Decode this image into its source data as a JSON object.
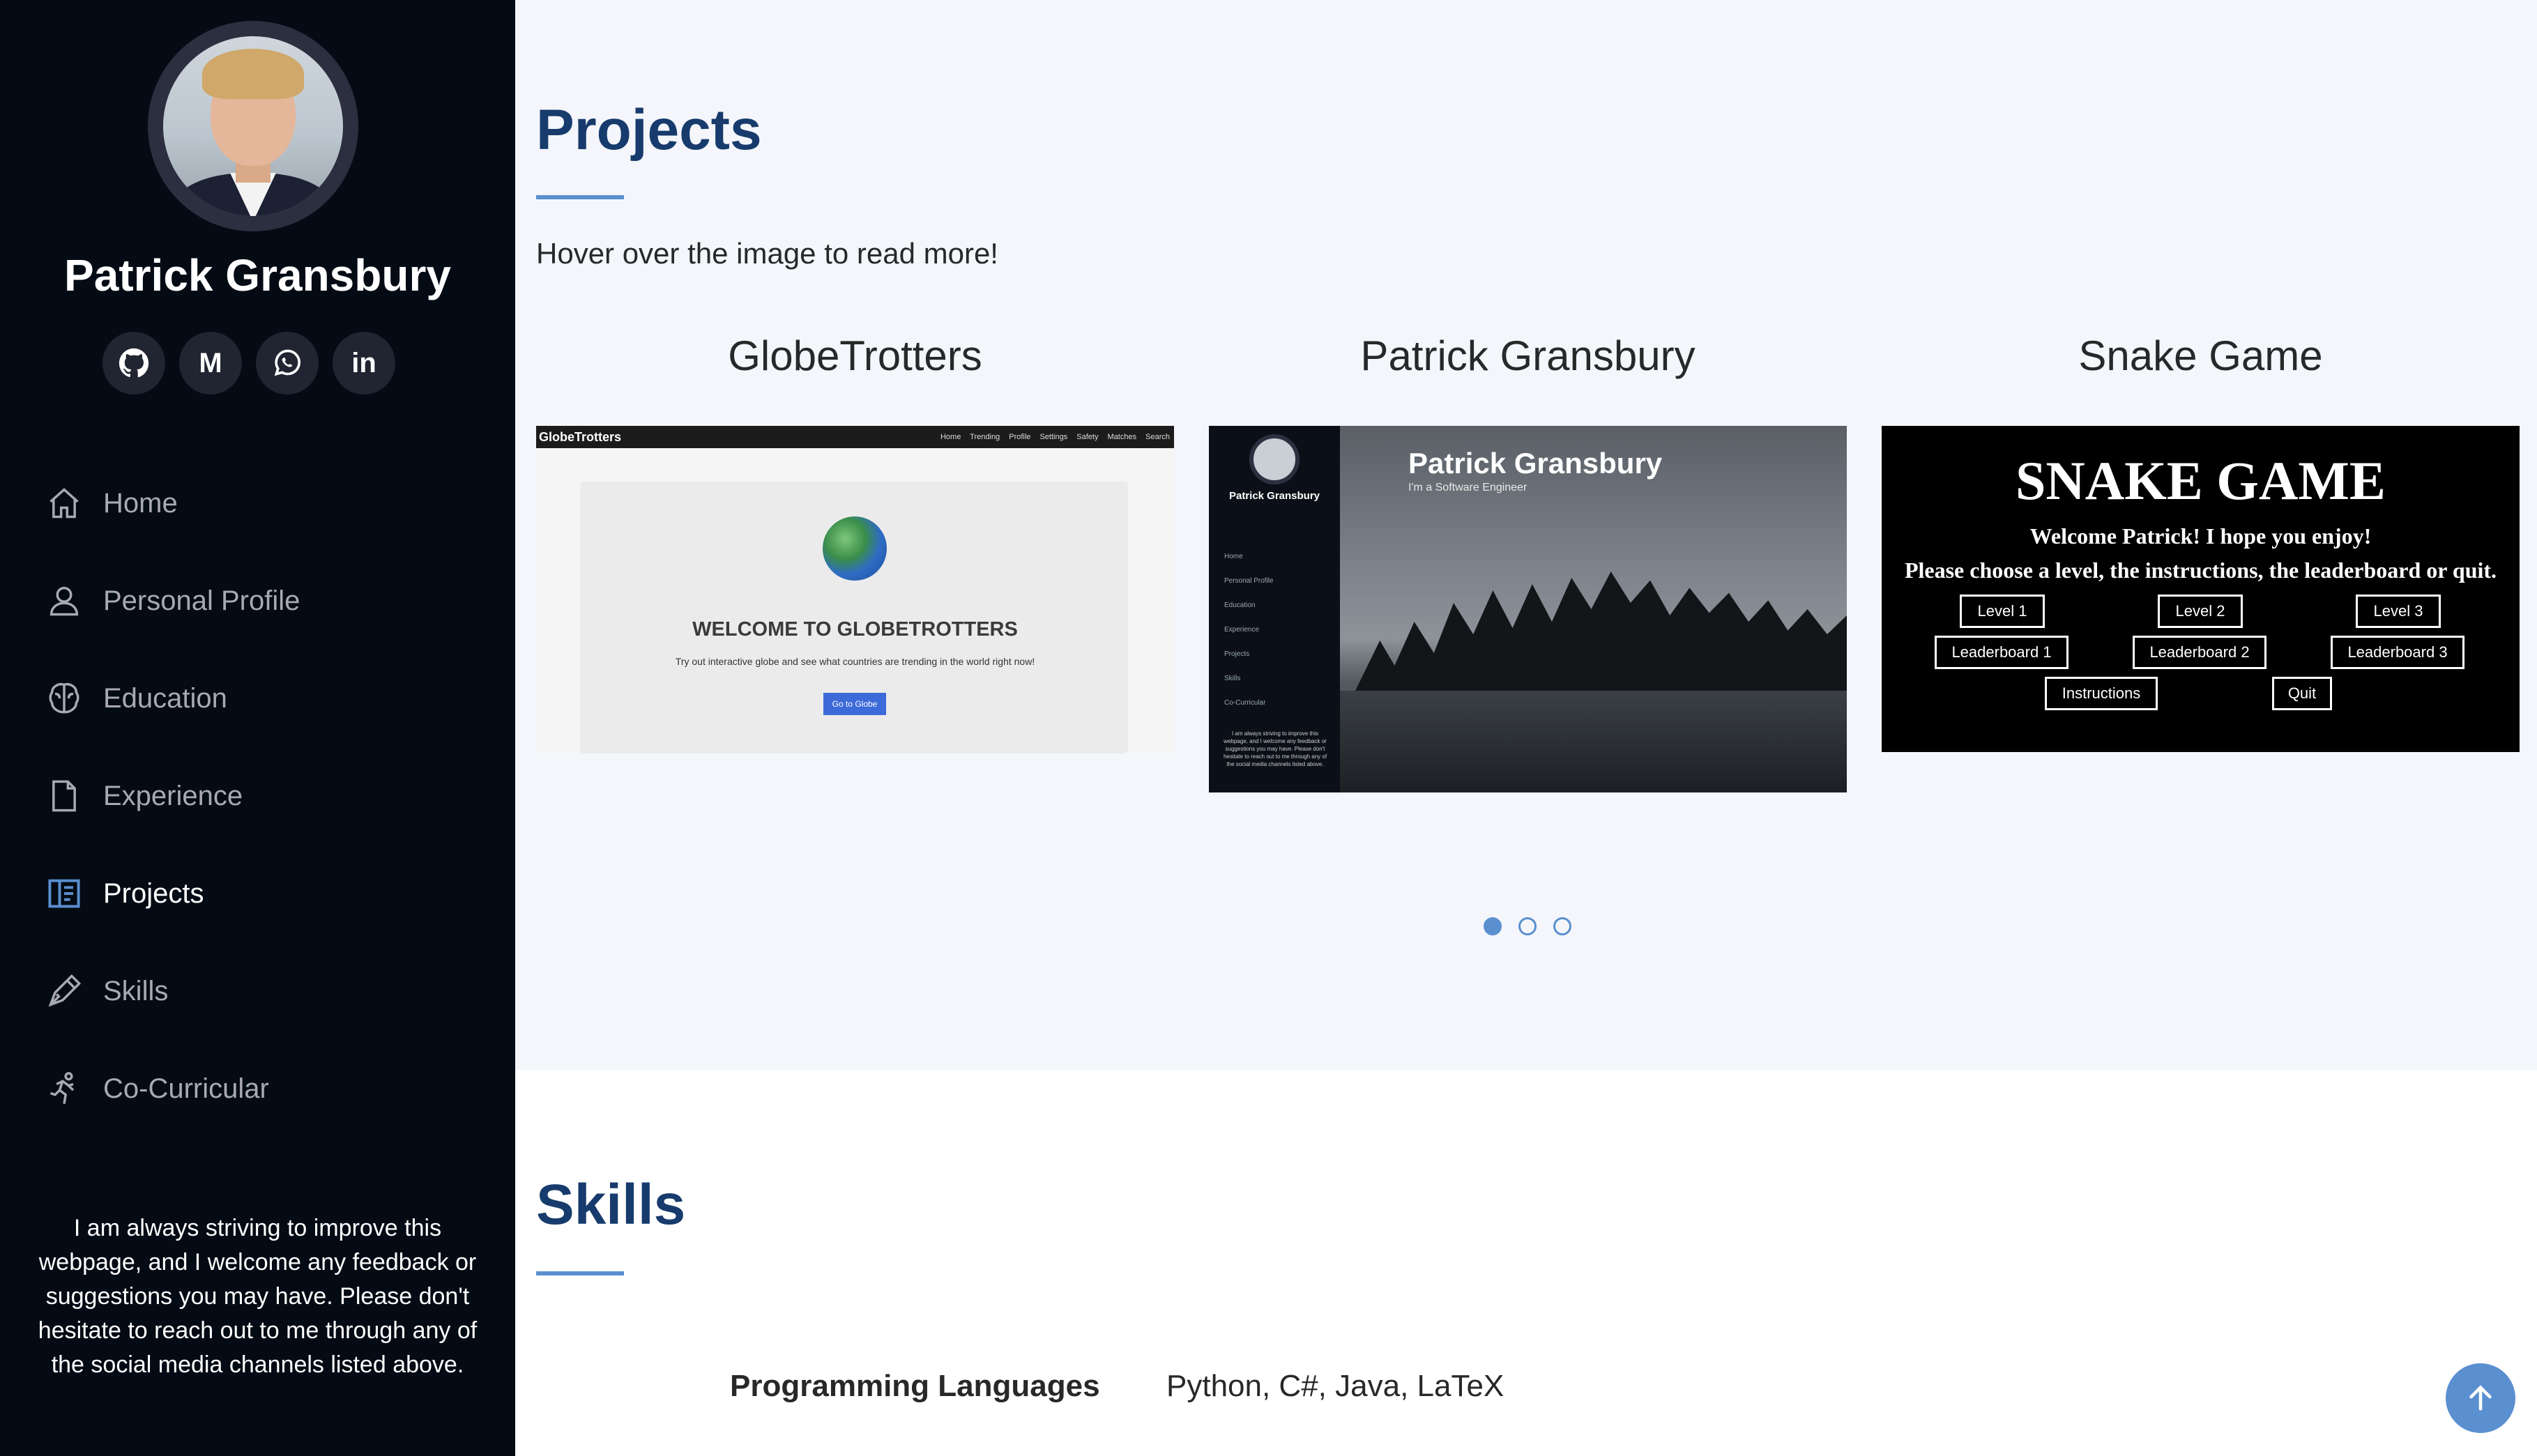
{
  "sidebar": {
    "name": "Patrick Gransbury",
    "socials": [
      {
        "icon": "github-icon"
      },
      {
        "icon": "gmail-icon",
        "glyph": "M"
      },
      {
        "icon": "whatsapp-icon"
      },
      {
        "icon": "linkedin-icon",
        "glyph": "in"
      }
    ],
    "nav": [
      {
        "label": "Home",
        "icon": "home-icon"
      },
      {
        "label": "Personal Profile",
        "icon": "person-icon"
      },
      {
        "label": "Education",
        "icon": "brain-icon"
      },
      {
        "label": "Experience",
        "icon": "file-icon"
      },
      {
        "label": "Projects",
        "icon": "layout-icon",
        "active": true
      },
      {
        "label": "Skills",
        "icon": "pen-icon"
      },
      {
        "label": "Co-Curricular",
        "icon": "running-icon"
      }
    ],
    "footer_note": "I am always striving to improve this webpage, and I welcome any feedback or suggestions you may have. Please don't hesitate to reach out to me through any of the social media channels listed above."
  },
  "projects": {
    "title": "Projects",
    "hint": "Hover over the image to read more!",
    "cards": [
      {
        "title": "GlobeTrotters",
        "thumb": {
          "brand": "GlobeTrotters",
          "links": "Home Trending Profile Settings Safety Matches Search",
          "heading": "WELCOME TO GLOBETROTTERS",
          "tagline": "Try out interactive globe and see what countries are trending in the world right now!",
          "button": "Go to Globe"
        }
      },
      {
        "title": "Patrick Gransbury",
        "thumb": {
          "name": "Patrick Gransbury",
          "subtitle": "I'm a Software Engineer",
          "nav": [
            "Home",
            "Personal Profile",
            "Education",
            "Experience",
            "Projects",
            "Skills",
            "Co-Curricular"
          ],
          "note": "I am always striving to improve this webpage, and I welcome any feedback or suggestions you may have. Please don't hesitate to reach out to me through any of the social media channels listed above."
        }
      },
      {
        "title": "Snake Game",
        "thumb": {
          "heading": "SNAKE GAME",
          "line1": "Welcome Patrick! I hope you enjoy!",
          "line2": "Please choose a level, the instructions, the leaderboard or quit.",
          "buttons": [
            "Level 1",
            "Level 2",
            "Level 3",
            "Leaderboard 1",
            "Leaderboard 2",
            "Leaderboard 3",
            "Instructions",
            "Quit"
          ]
        }
      }
    ],
    "carousel": {
      "pages": 3,
      "active": 1
    }
  },
  "skills": {
    "title": "Skills",
    "rows": [
      {
        "label": "Programming Languages",
        "value": "Python, C#, Java, LaTeX"
      }
    ]
  },
  "colors": {
    "sidebar_bg": "#040b14",
    "accent": "#5a8fd0",
    "heading": "#173b6c",
    "page_bg": "#f4f6fb"
  }
}
